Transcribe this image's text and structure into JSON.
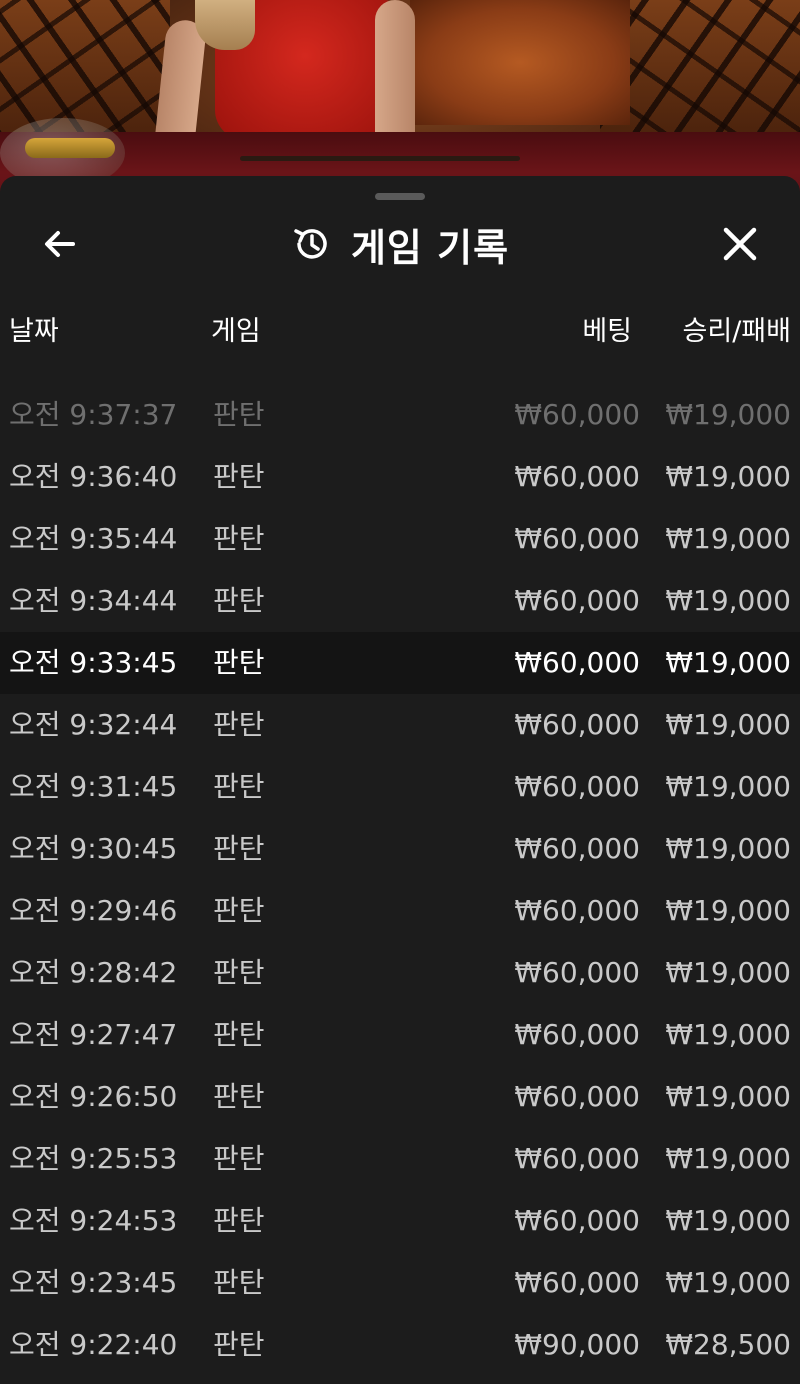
{
  "header": {
    "title": "게임 기록",
    "back_icon": "arrow-left-icon",
    "history_icon": "history-clock-icon",
    "close_icon": "close-icon"
  },
  "columns": {
    "date": "날짜",
    "game": "게임",
    "bet": "베팅",
    "result": "승리/패배"
  },
  "colors": {
    "panel_bg": "#1c1c1c",
    "highlight_row_bg": "#141414",
    "text_primary": "#ffffff",
    "text_secondary": "#c9c9c9",
    "text_faded": "#6f6f6f"
  },
  "rows": [
    {
      "time": "오전 9:37:37",
      "game": "판탄",
      "bet": "₩60,000",
      "result": "₩19,000"
    },
    {
      "time": "오전 9:36:40",
      "game": "판탄",
      "bet": "₩60,000",
      "result": "₩19,000"
    },
    {
      "time": "오전 9:35:44",
      "game": "판탄",
      "bet": "₩60,000",
      "result": "₩19,000"
    },
    {
      "time": "오전 9:34:44",
      "game": "판탄",
      "bet": "₩60,000",
      "result": "₩19,000"
    },
    {
      "time": "오전 9:33:45",
      "game": "판탄",
      "bet": "₩60,000",
      "result": "₩19,000"
    },
    {
      "time": "오전 9:32:44",
      "game": "판탄",
      "bet": "₩60,000",
      "result": "₩19,000"
    },
    {
      "time": "오전 9:31:45",
      "game": "판탄",
      "bet": "₩60,000",
      "result": "₩19,000"
    },
    {
      "time": "오전 9:30:45",
      "game": "판탄",
      "bet": "₩60,000",
      "result": "₩19,000"
    },
    {
      "time": "오전 9:29:46",
      "game": "판탄",
      "bet": "₩60,000",
      "result": "₩19,000"
    },
    {
      "time": "오전 9:28:42",
      "game": "판탄",
      "bet": "₩60,000",
      "result": "₩19,000"
    },
    {
      "time": "오전 9:27:47",
      "game": "판탄",
      "bet": "₩60,000",
      "result": "₩19,000"
    },
    {
      "time": "오전 9:26:50",
      "game": "판탄",
      "bet": "₩60,000",
      "result": "₩19,000"
    },
    {
      "time": "오전 9:25:53",
      "game": "판탄",
      "bet": "₩60,000",
      "result": "₩19,000"
    },
    {
      "time": "오전 9:24:53",
      "game": "판탄",
      "bet": "₩60,000",
      "result": "₩19,000"
    },
    {
      "time": "오전 9:23:45",
      "game": "판탄",
      "bet": "₩60,000",
      "result": "₩19,000"
    },
    {
      "time": "오전 9:22:40",
      "game": "판탄",
      "bet": "₩90,000",
      "result": "₩28,500"
    }
  ]
}
